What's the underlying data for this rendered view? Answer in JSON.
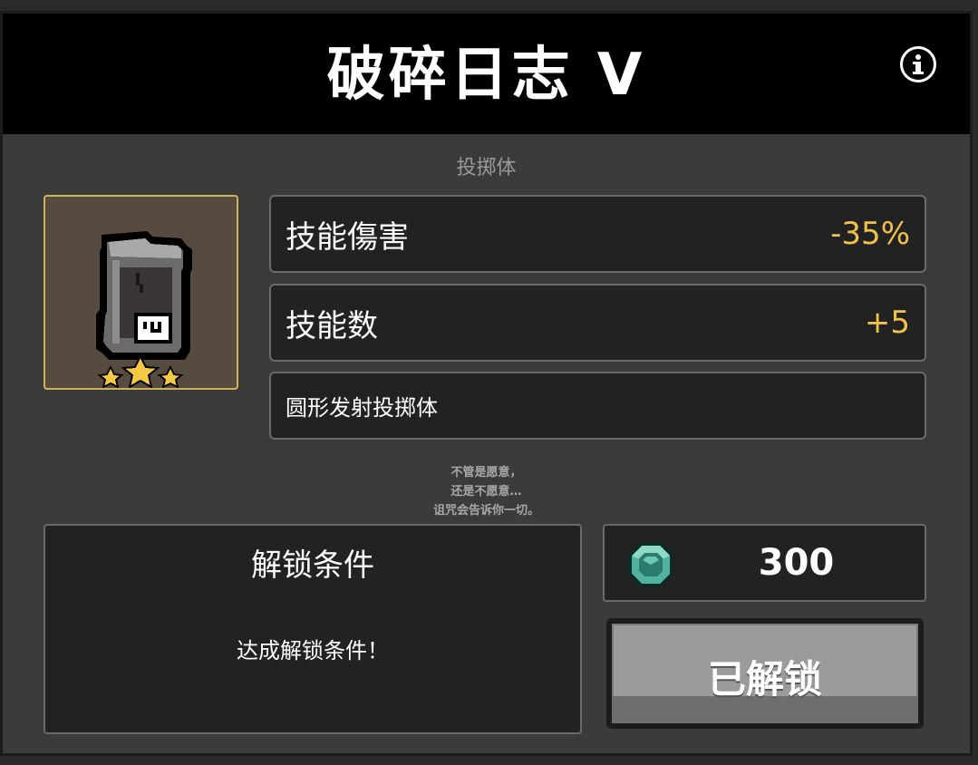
{
  "title": "破碎日志 V",
  "category": "投掷体",
  "item": {
    "icon": "broken-journal-icon",
    "star_rating": 3,
    "frame_color": "#cdb35a"
  },
  "stats": [
    {
      "label": "技能傷害",
      "value": "-35%"
    },
    {
      "label": "技能数",
      "value": "+5"
    }
  ],
  "description": "圆形发射投掷体",
  "flavor_text": [
    "不管是愿意，",
    "还是不愿意…",
    "诅咒会告诉你一切。"
  ],
  "unlock": {
    "title": "解锁条件",
    "text": "达成解锁条件！"
  },
  "price": {
    "currency_icon": "gem-icon",
    "amount": "300"
  },
  "status_button": "已解锁",
  "colors": {
    "accent_value": "#f0c24a",
    "panel_bg": "#3b3b3b",
    "box_bg": "#222222"
  }
}
